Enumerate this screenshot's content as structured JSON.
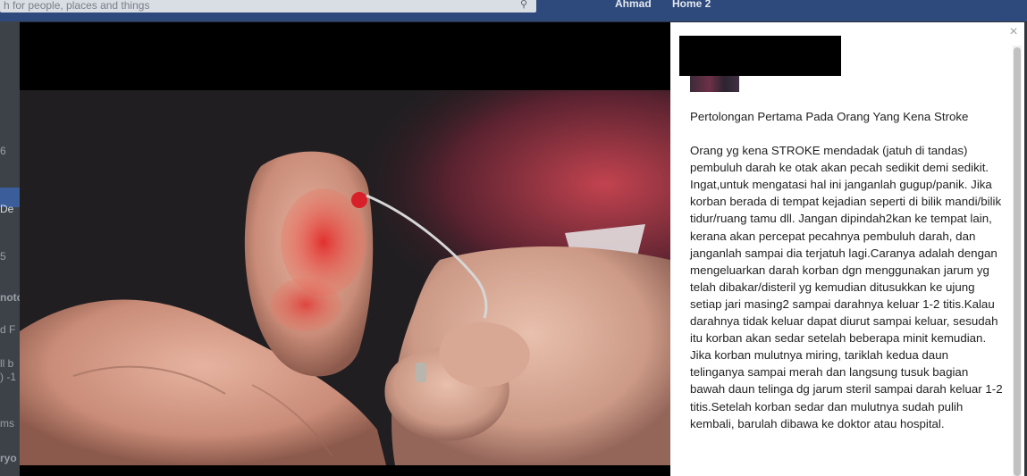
{
  "background": {
    "search_placeholder": "h for people, places and things",
    "user_name": "Ahmad",
    "home_label": "Home  2",
    "left_fragments": [
      "6",
      "De",
      "5",
      "noto",
      "d F",
      "ll b",
      ") -1",
      "ms",
      "ryo"
    ]
  },
  "post": {
    "title": "Pertolongan Pertama Pada Orang Yang Kena Stroke",
    "body": "Orang yg kena STROKE mendadak (jatuh di tandas) pembuluh darah ke otak akan pecah sedikit demi sedikit. Ingat,untuk mengatasi hal ini janganlah gugup/panik. Jika korban berada di tempat kejadian seperti di bilik mandi/bilik tidur/ruang tamu dll. Jangan dipindah2kan ke tempat lain, kerana akan percepat pecahnya pembuluh darah, dan janganlah sampai dia terjatuh lagi.Caranya adalah dengan mengeluarkan darah korban dgn menggunakan jarum yg telah dibakar/disteril yg kemudian ditusukkan ke ujung setiap jari masing2 sampai darahnya keluar 1-2 titis.Kalau darahnya tidak keluar dapat diurut sampai keluar, sesudah itu korban akan sedar setelah beberapa minit kemudian. Jika korban mulutnya miring, tariklah kedua daun telinganya sampai merah dan langsung tusuk bagian bawah daun telinga dg jarum steril sampai darah keluar 1-2 titis.Setelah korban sedar dan mulutnya sudah pulih kembali, barulah dibawa ke doktor atau hospital."
  },
  "close_label": "×",
  "icons": {
    "search": "search-icon",
    "close": "close-icon"
  },
  "colors": {
    "topbar": "#2e4a7c",
    "panel": "#ffffff",
    "text": "#222222",
    "blood": "#d8202a"
  }
}
